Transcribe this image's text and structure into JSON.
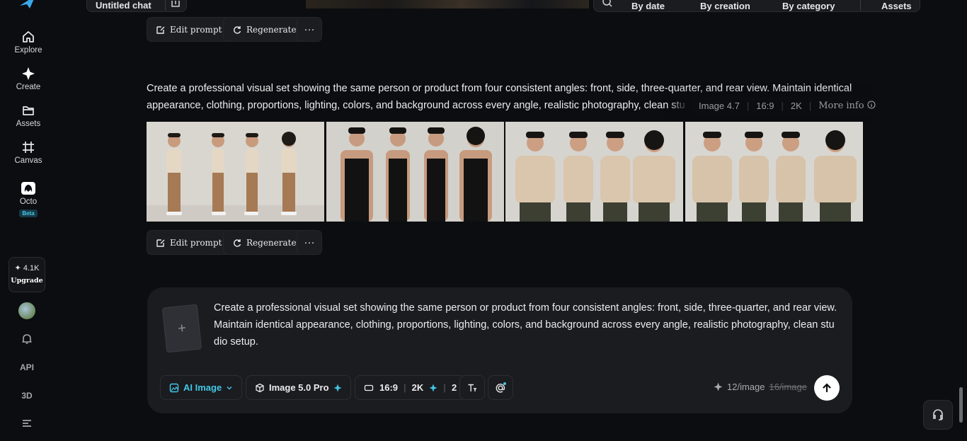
{
  "sidebar": {
    "items": [
      {
        "label": "Explore",
        "icon": "home-icon"
      },
      {
        "label": "Create",
        "icon": "sparkle-icon"
      },
      {
        "label": "Assets",
        "icon": "folder-icon"
      },
      {
        "label": "Canvas",
        "icon": "canvas-icon"
      },
      {
        "label": "Octo",
        "icon": "octo-icon",
        "badge": "Beta"
      }
    ],
    "credits": {
      "amount": "✦ 4.1K",
      "upgrade_label": "Upgrade"
    },
    "api_label": "API",
    "three_d_label": "3D"
  },
  "topbar": {
    "chat_title": "Untitled chat",
    "filters": [
      "By date",
      "By creation",
      "By category"
    ],
    "assets_label": "Assets"
  },
  "actions": {
    "edit_prompt": "Edit prompt",
    "regenerate": "Regenerate",
    "more": "···"
  },
  "generation": {
    "prompt_line1": "Create a professional visual set showing the same person or product from four consistent angles: front, side, three-quarter, and rear view. Maintain identical",
    "prompt_line2": "appearance, clothing, proportions, lighting, colors, and background across every angle, realistic photography, clean stu",
    "model": "Image 4.7",
    "ratio": "16:9",
    "resolution": "2K",
    "more_info": "More info"
  },
  "composer": {
    "text": "Create a professional visual set showing the same person or product from four consistent angles: front, side, three-quarter, and rear view. Maintain identical appearance, clothing, proportions, lighting, colors, and background across every angle, realistic photography, clean stu dio setup.",
    "mode_label": "AI Image",
    "model_label": "Image 5.0 Pro",
    "ratio": "16:9",
    "resolution": "2K",
    "count": "2",
    "cost": "12/image",
    "old_cost": "16/image"
  },
  "colors": {
    "accent": "#41c7e6",
    "background": "#0c0d10",
    "panel": "#1b1c20"
  }
}
